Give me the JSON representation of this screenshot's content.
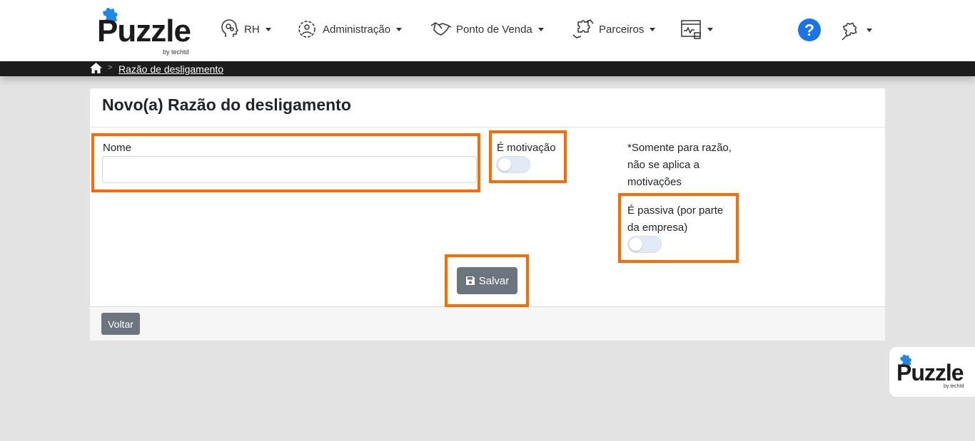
{
  "brand": {
    "name": "Puzzle",
    "tagline": "by techtd"
  },
  "nav": {
    "rh": "RH",
    "admin": "Administração",
    "pdv": "Ponto de Venda",
    "parceiros": "Parceiros"
  },
  "help": {
    "symbol": "?"
  },
  "breadcrumb": {
    "current": "Razão de desligamento"
  },
  "page": {
    "title": "Novo(a) Razão do desligamento"
  },
  "form": {
    "nome_label": "Nome",
    "nome_value": "",
    "motivacao_label": "É motivação",
    "motivacao_on": false,
    "note": "*Somente para razão, não se aplica a motivações",
    "passiva_label": "É passiva (por parte da empresa)",
    "passiva_on": false
  },
  "buttons": {
    "save": "Salvar",
    "back": "Voltar"
  },
  "colors": {
    "highlight": "#ff6a00",
    "primary_blue": "#1a73e8",
    "button_gray": "#6c757d",
    "brand_blue": "#1e88e5"
  },
  "icons": [
    "puzzle-logo-icon",
    "head-gears-icon",
    "gear-person-icon",
    "handshake-icon",
    "puzzle-hands-icon",
    "dashboard-icon",
    "help-icon",
    "puzzle-settings-icon",
    "home-icon",
    "save-icon"
  ]
}
